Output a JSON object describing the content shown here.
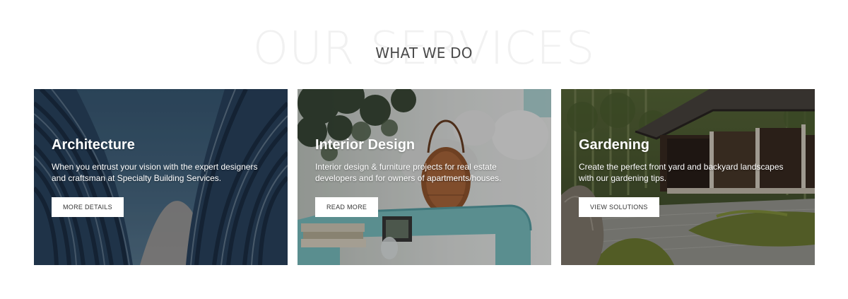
{
  "section": {
    "background_title": "OUR SERVICES",
    "title": "WHAT WE DO"
  },
  "cards": [
    {
      "title": "Architecture",
      "description": "When you entrust your vision with the expert designers and craftsman at Specialty Building Services.",
      "button_label": "MORE DETAILS",
      "image": "architecture-building-photo"
    },
    {
      "title": "Interior Design",
      "description": "Interior design & furniture projects for real estate developers and for owners of apartments/houses.",
      "button_label": "READ MORE",
      "image": "interior-living-room-photo"
    },
    {
      "title": "Gardening",
      "description": "Create the perfect front yard and backyard landscapes with our gardening tips.",
      "button_label": "VIEW SOLUTIONS",
      "image": "japanese-garden-photo"
    }
  ],
  "colors": {
    "background_title": "#f1f1f1",
    "title": "#4a4a4a",
    "button_bg": "#ffffff",
    "button_text": "#333333"
  }
}
